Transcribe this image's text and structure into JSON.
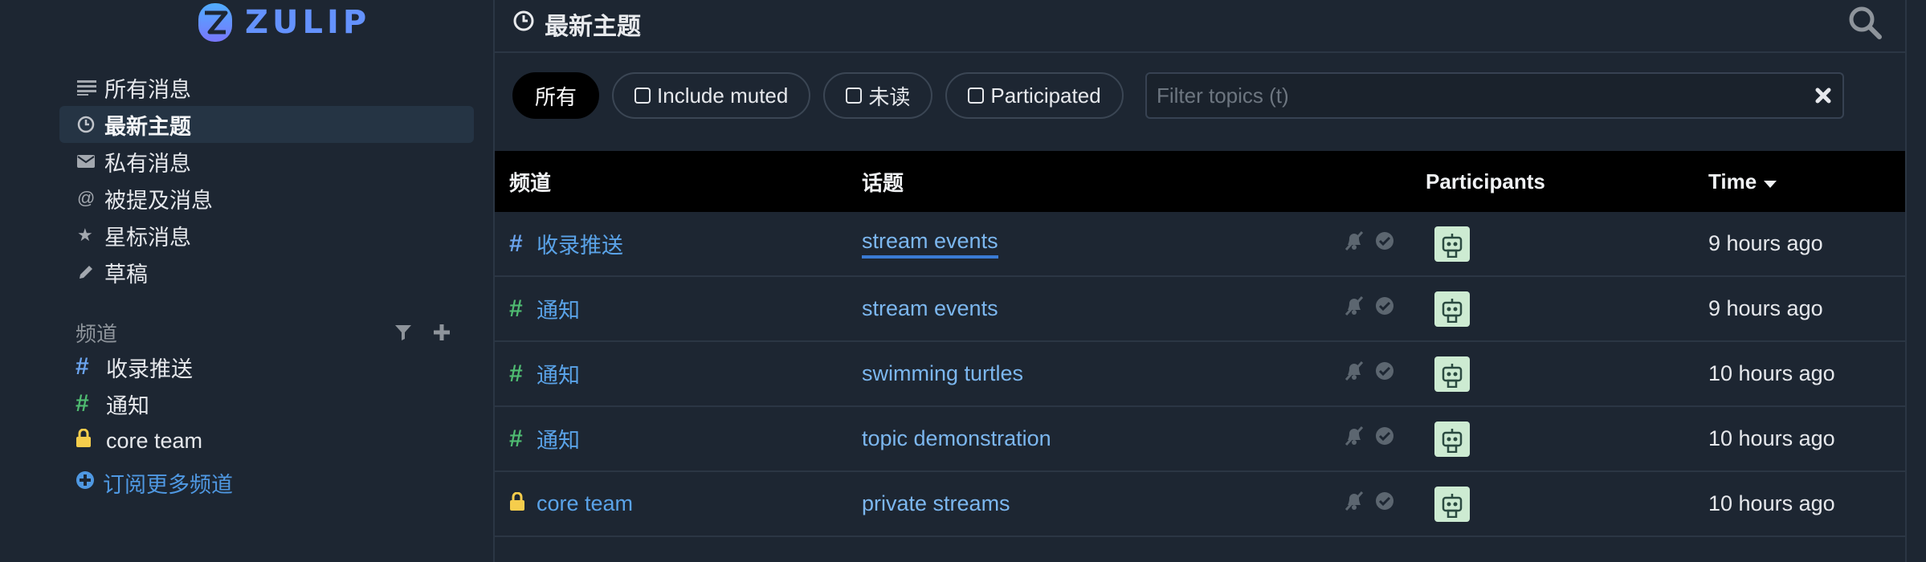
{
  "app": {
    "logo_text": "ZULIP",
    "brand_color": "#6492fe"
  },
  "sidebar": {
    "nav": [
      {
        "label": "所有消息",
        "icon": "all-messages-icon"
      },
      {
        "label": "最新主题",
        "icon": "clock-icon",
        "active": true
      },
      {
        "label": "私有消息",
        "icon": "envelope-icon"
      },
      {
        "label": "被提及消息",
        "icon": "at-icon"
      },
      {
        "label": "星标消息",
        "icon": "star-icon"
      },
      {
        "label": "草稿",
        "icon": "pencil-icon"
      }
    ],
    "streams_header": "频道",
    "streams": [
      {
        "name": "收录推送",
        "color": "#6ba4ef",
        "icon": "hash"
      },
      {
        "name": "通知",
        "color": "#4fbb71",
        "icon": "hash"
      },
      {
        "name": "core team",
        "color": "#f5cd4c",
        "icon": "lock"
      }
    ],
    "subscribe_more": "订阅更多频道"
  },
  "header": {
    "title": "最新主题"
  },
  "filters": {
    "all": "所有",
    "include_muted": "Include muted",
    "unread": "未读",
    "participated": "Participated",
    "search_placeholder": "Filter topics (t)"
  },
  "table": {
    "columns": {
      "stream": "频道",
      "topic": "话题",
      "participants": "Participants",
      "time": "Time"
    },
    "sort": {
      "column": "time",
      "direction": "desc"
    },
    "rows": [
      {
        "stream": "收录推送",
        "stream_icon": "hash",
        "stream_color": "#6ba4ef",
        "topic": "stream events",
        "time": "9 hours ago"
      },
      {
        "stream": "通知",
        "stream_icon": "hash",
        "stream_color": "#4fbb71",
        "topic": "stream events",
        "time": "9 hours ago"
      },
      {
        "stream": "通知",
        "stream_icon": "hash",
        "stream_color": "#4fbb71",
        "topic": "swimming turtles",
        "time": "10 hours ago"
      },
      {
        "stream": "通知",
        "stream_icon": "hash",
        "stream_color": "#4fbb71",
        "topic": "topic demonstration",
        "time": "10 hours ago"
      },
      {
        "stream": "core team",
        "stream_icon": "lock",
        "stream_color": "#f5cd4c",
        "topic": "private streams",
        "time": "10 hours ago"
      }
    ]
  }
}
